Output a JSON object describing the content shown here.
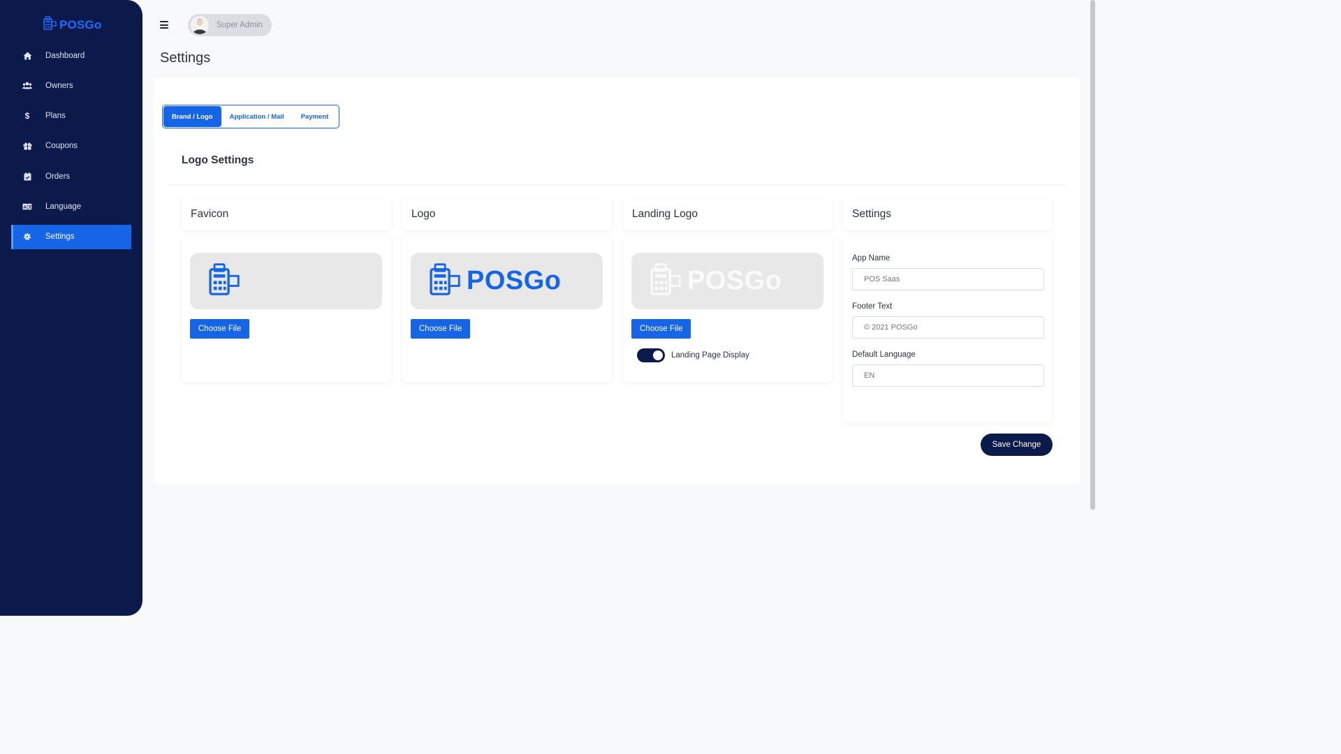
{
  "brand": {
    "name": "POSGo",
    "color": "#1f6bff"
  },
  "sidebar": {
    "items": [
      {
        "label": "Dashboard",
        "icon": "home-icon"
      },
      {
        "label": "Owners",
        "icon": "users-icon"
      },
      {
        "label": "Plans",
        "icon": "dollar-icon"
      },
      {
        "label": "Coupons",
        "icon": "gift-icon"
      },
      {
        "label": "Orders",
        "icon": "calendar-check-icon"
      },
      {
        "label": "Language",
        "icon": "language-icon"
      },
      {
        "label": "Settings",
        "icon": "gear-icon",
        "active": true
      }
    ]
  },
  "header": {
    "user_name": "Super Admin"
  },
  "page": {
    "title": "Settings"
  },
  "tabs": [
    {
      "label": "Brand / Logo",
      "active": true
    },
    {
      "label": "Application / Mail"
    },
    {
      "label": "Payment"
    }
  ],
  "section": {
    "title": "Logo Settings"
  },
  "favicon": {
    "title": "Favicon",
    "button": "Choose File"
  },
  "logo": {
    "title": "Logo",
    "button": "Choose File",
    "wordmark": "POSGo"
  },
  "landing_logo": {
    "title": "Landing Logo",
    "button": "Choose File",
    "wordmark": "POSGo",
    "toggle_label": "Landing Page Display",
    "toggle_on": true
  },
  "settings": {
    "title": "Settings",
    "app_name_label": "App Name",
    "app_name_placeholder": "POS Saas",
    "footer_text_label": "Footer Text",
    "footer_text_placeholder": "© 2021 POSGo",
    "default_language_label": "Default Language",
    "default_language_placeholder": "EN",
    "save_button": "Save Change"
  },
  "colors": {
    "sidebar_bg": "#0b1a4b",
    "primary": "#1565e6"
  }
}
